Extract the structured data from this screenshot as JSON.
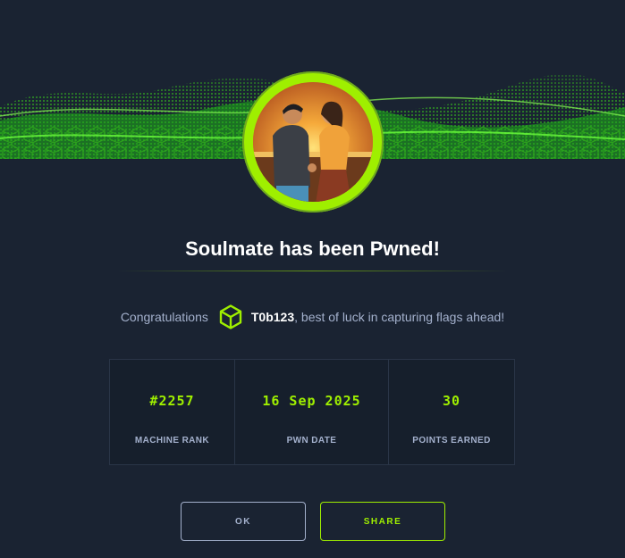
{
  "dialog": {
    "title": "Soulmate has been Pwned!",
    "congrats_prefix": "Congratulations",
    "username": "T0b123",
    "congrats_suffix": ", best of luck in capturing flags ahead!"
  },
  "stats": [
    {
      "value": "#2257",
      "label": "MACHINE RANK"
    },
    {
      "value": "16 Sep 2025",
      "label": "PWN DATE"
    },
    {
      "value": "30",
      "label": "POINTS EARNED"
    }
  ],
  "buttons": {
    "ok_label": "OK",
    "share_label": "SHARE"
  },
  "colors": {
    "accent": "#9fef00",
    "background": "#1a2332",
    "muted_text": "#a4b1cd"
  },
  "icons": {
    "user_badge": "hexagon-cube-icon"
  }
}
